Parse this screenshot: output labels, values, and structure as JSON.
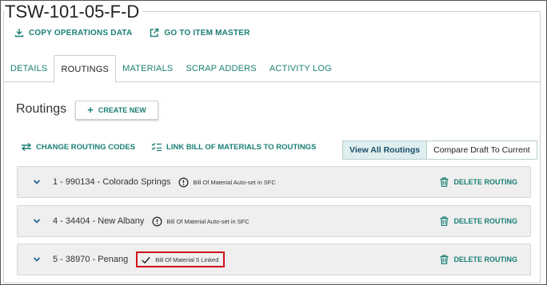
{
  "page": {
    "title": "TSW-101-05-F-D"
  },
  "toolbar": {
    "copy_label": "COPY OPERATIONS DATA",
    "goto_label": "GO TO ITEM MASTER"
  },
  "tabs": [
    {
      "label": "DETAILS",
      "active": false
    },
    {
      "label": "ROUTINGS",
      "active": true
    },
    {
      "label": "MATERIALS",
      "active": false
    },
    {
      "label": "SCRAP ADDERS",
      "active": false
    },
    {
      "label": "ACTIVITY LOG",
      "active": false
    }
  ],
  "routings": {
    "heading": "Routings",
    "create_label": "CREATE NEW",
    "change_codes_label": "CHANGE ROUTING CODES",
    "link_bom_label": "LINK BILL OF MATERIALS TO ROUTINGS",
    "view_all_label": "View All Routings",
    "compare_label": "Compare Draft To Current",
    "delete_label": "DELETE ROUTING",
    "items": [
      {
        "name": "1 - 990134 - Colorado Springs",
        "status": "Bill Of Material Auto-set in SFC",
        "status_icon": "alert-circle-icon"
      },
      {
        "name": "4 - 34404 - New Albany",
        "status": "Bill Of Material Auto-set in SFC",
        "status_icon": "alert-circle-icon"
      },
      {
        "name": "5 - 38970 - Penang",
        "status": "Bill Of Material 5 Linked",
        "status_icon": "check-icon",
        "highlighted": true
      }
    ]
  },
  "colors": {
    "accent": "#1a7f74",
    "highlight_border": "#d0101a",
    "row_bg": "#efefef"
  }
}
